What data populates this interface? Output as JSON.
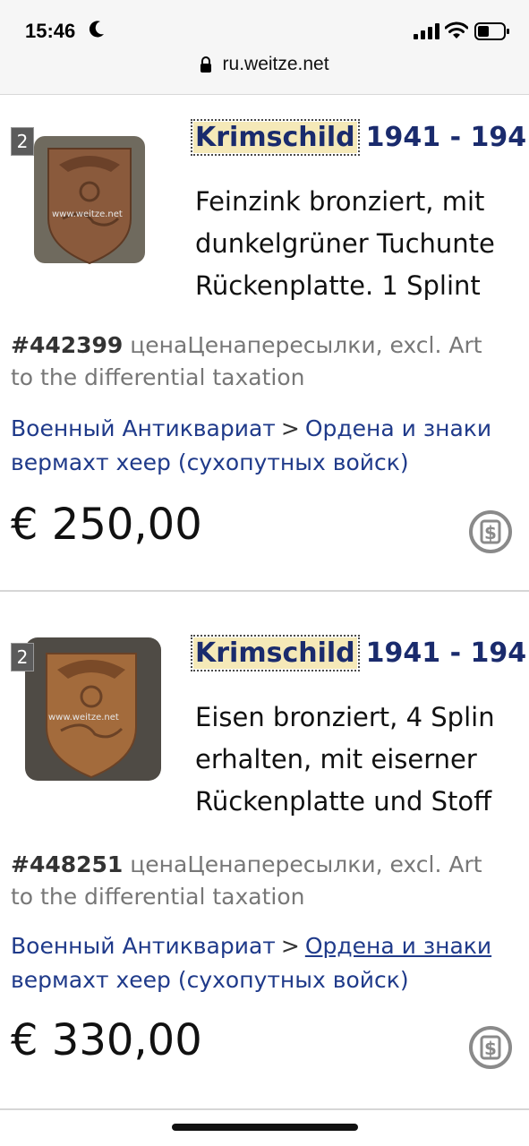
{
  "status": {
    "time": "15:46"
  },
  "browser": {
    "url": "ru.weitze.net"
  },
  "items": [
    {
      "badge": "2",
      "title_highlight": "Krimschild",
      "title_rest": "1941 - 194",
      "desc_lines": [
        "Feinzink bronziert, mit",
        "dunkelgrüner Tuchunte",
        "Rückenplatte. 1 Splint"
      ],
      "number": "#442399",
      "meta_rest": " ценаЦенапересылки, excl. Art",
      "meta_line2": "to the differential taxation",
      "cat1": "Военный Антиквариат",
      "cat_sep": ">",
      "cat2": "Ордена и знаки",
      "cat_line2": "вермахт хеер (сухопутных войск)",
      "price": "€ 250,00",
      "watermark": "www.weitze.net"
    },
    {
      "badge": "2",
      "title_highlight": "Krimschild",
      "title_rest": "1941 - 194",
      "desc_lines": [
        "Eisen bronziert, 4 Splin",
        "erhalten, mit eiserner",
        "Rückenplatte und Stoff"
      ],
      "number": "#448251",
      "meta_rest": " ценаЦенапересылки, excl. Art",
      "meta_line2": "to the differential taxation",
      "cat1": "Военный Антиквариат",
      "cat_sep": ">",
      "cat2": "Ордена и знаки",
      "cat_line2": "вермахт хеер (сухопутных войск)",
      "price": "€ 330,00",
      "watermark": "www.weitze.net"
    }
  ]
}
